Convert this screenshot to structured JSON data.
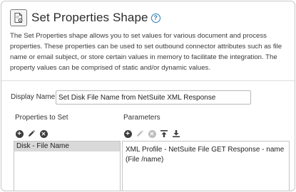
{
  "header": {
    "title": "Set Properties Shape",
    "shape_icon": "document-gear-icon",
    "help_icon": "question-circle-icon",
    "help_glyph": "?"
  },
  "description": "The Set Properties shape allows you to set values for various document and process properties. These properties can be used to set outbound connector attributes such as file name or email subject, or store certain values in memory to facilitate the integration. The property values can be comprised of static and/or dynamic values.",
  "display_name": {
    "label": "Display Name",
    "value": "Set Disk File Name from NetSuite XML Response"
  },
  "properties_to_set": {
    "label": "Properties to Set",
    "toolbar": [
      {
        "icon": "add-icon",
        "glyph": "+"
      },
      {
        "icon": "edit-icon",
        "glyph": "✎"
      },
      {
        "icon": "delete-icon",
        "glyph": "✕"
      }
    ],
    "items": [
      "Disk - File Name"
    ]
  },
  "parameters": {
    "label": "Parameters",
    "toolbar": [
      {
        "icon": "add-icon",
        "glyph": "+"
      },
      {
        "icon": "edit-icon",
        "glyph": "✎"
      },
      {
        "icon": "delete-icon",
        "glyph": "✕"
      },
      {
        "icon": "move-to-top-icon",
        "glyph": "⤒"
      },
      {
        "icon": "move-to-bottom-icon",
        "glyph": "⤓"
      }
    ],
    "items": [
      "XML Profile - NetSuite File GET Response - name (File /name)"
    ]
  },
  "colors": {
    "accent": "#2a7ab0",
    "selected_row": "#d9d9d9",
    "icon_active": "#3d3d3d",
    "icon_disabled": "#bdbdbd"
  }
}
